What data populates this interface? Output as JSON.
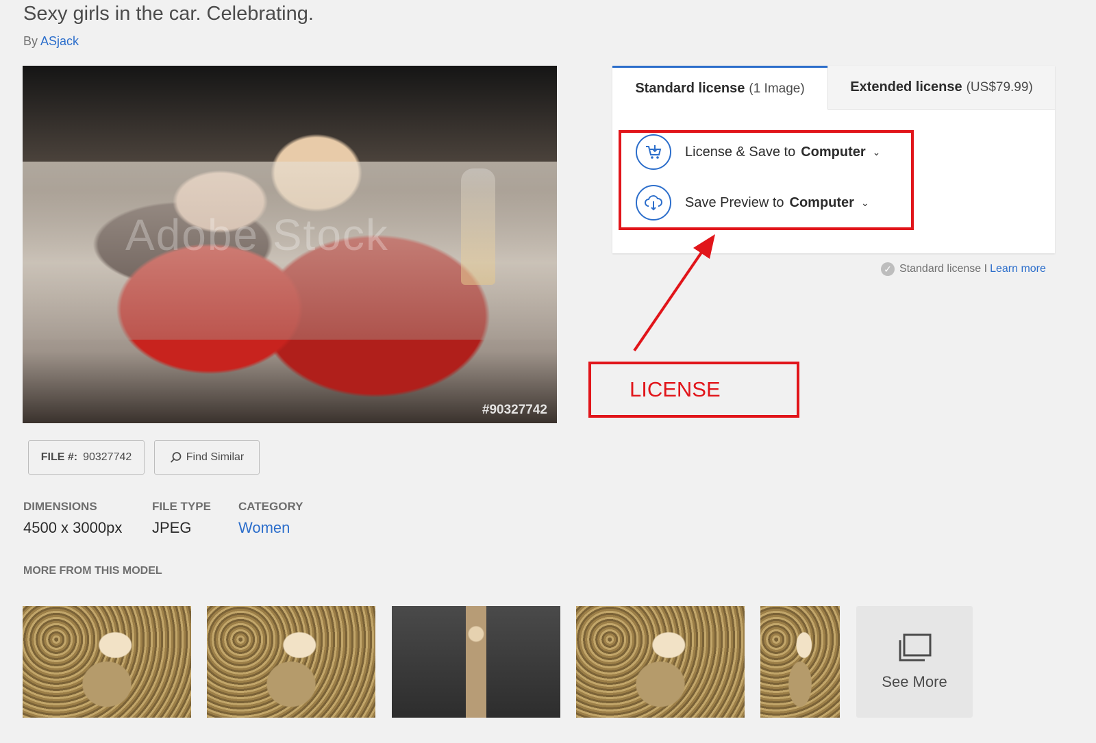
{
  "page": {
    "title": "Sexy girls in the car. Celebrating.",
    "by_label": "By",
    "author": "ASjack"
  },
  "image": {
    "watermark": "Adobe Stock",
    "file_tag": "#90327742"
  },
  "actions": {
    "file_label": "FILE #:",
    "file_number": "90327742",
    "find_similar": "Find Similar"
  },
  "details": {
    "dimensions_label": "DIMENSIONS",
    "dimensions_value": "4500 x 3000px",
    "filetype_label": "FILE TYPE",
    "filetype_value": "JPEG",
    "category_label": "CATEGORY",
    "category_value": "Women"
  },
  "more": {
    "title": "MORE FROM THIS MODEL",
    "see_more": "See More"
  },
  "license": {
    "tabs": [
      {
        "label": "Standard license",
        "sub": "(1 Image)"
      },
      {
        "label": "Extended license",
        "sub": "(US$79.99)"
      }
    ],
    "license_save_prefix": "License & Save to",
    "license_save_target": "Computer",
    "preview_prefix": "Save Preview to",
    "preview_target": "Computer",
    "note_text": "Standard license I",
    "learn_more": "Learn more"
  },
  "annotation": {
    "label": "LICENSE",
    "color": "#e1151a"
  },
  "colors": {
    "accent": "#2c6ecb",
    "background": "#f1f1f1"
  }
}
